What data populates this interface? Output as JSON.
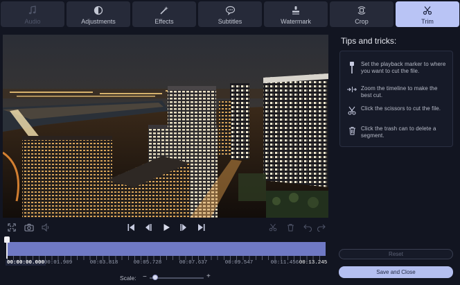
{
  "tabs": [
    {
      "label": "Audio",
      "icon": "music-note-icon",
      "state": "disabled"
    },
    {
      "label": "Adjustments",
      "icon": "contrast-icon",
      "state": "normal"
    },
    {
      "label": "Effects",
      "icon": "magic-wand-icon",
      "state": "normal"
    },
    {
      "label": "Subtitles",
      "icon": "speech-bubble-icon",
      "state": "normal"
    },
    {
      "label": "Watermark",
      "icon": "stamp-icon",
      "state": "normal"
    },
    {
      "label": "Crop",
      "icon": "crop-rotate-icon",
      "state": "normal"
    },
    {
      "label": "Trim",
      "icon": "scissors-icon",
      "state": "active"
    }
  ],
  "tips": {
    "title": "Tips and tricks:",
    "items": [
      {
        "icon": "playback-marker-icon",
        "text": "Set the playback marker to where you want to cut the file."
      },
      {
        "icon": "zoom-timeline-icon",
        "text": "Zoom the timeline to make the best cut."
      },
      {
        "icon": "scissors-icon",
        "text": "Click the scissors to cut the file."
      },
      {
        "icon": "trash-icon",
        "text": "Click the trash can to delete a segment."
      }
    ]
  },
  "timeline": {
    "current_time": "00:00:00.000",
    "ticks": [
      "00:01.909",
      "00:03.818",
      "00:05.728",
      "00:07.637",
      "00:09.547",
      "00:11.456"
    ],
    "end_time": "00:13.245",
    "playhead_fraction": 0.0
  },
  "scale": {
    "label": "Scale:",
    "minus": "−",
    "plus": "+",
    "value_fraction": 0.06
  },
  "buttons": {
    "reset": "Reset",
    "save": "Save and Close"
  },
  "colors": {
    "accent": "#b4bff0",
    "timeline_fill": "#6f79c4",
    "background": "#121521"
  }
}
